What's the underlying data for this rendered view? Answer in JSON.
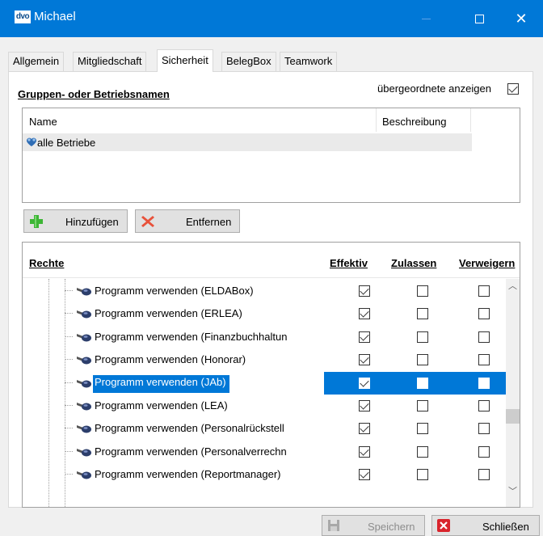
{
  "window": {
    "logo_text": "dvo",
    "title": "Michael",
    "close_symbol": "✕"
  },
  "tabs": [
    {
      "label": "Allgemein"
    },
    {
      "label": "Mitgliedschaft"
    },
    {
      "label": "Sicherheit",
      "active": true
    },
    {
      "label": "BelegBox"
    },
    {
      "label": "Teamwork"
    }
  ],
  "groups": {
    "title": "Gruppen- oder Betriebsnamen",
    "show_parent_label": "übergeordnete anzeigen",
    "show_parent_checked": true,
    "columns": {
      "name": "Name",
      "description": "Beschreibung"
    },
    "rows": [
      {
        "name": "alle Betriebe",
        "icon": "group-icon"
      }
    ]
  },
  "buttons": {
    "add": "Hinzufügen",
    "remove": "Entfernen"
  },
  "rights": {
    "columns": {
      "rights": "Rechte",
      "effective": "Effektiv",
      "allow": "Zulassen",
      "deny": "Verweigern"
    },
    "rows": [
      {
        "label": "Programm verwenden (ELDABox)",
        "effective": true,
        "allow": false,
        "deny": false
      },
      {
        "label": "Programm verwenden (ERLEA)",
        "effective": true,
        "allow": false,
        "deny": false
      },
      {
        "label": "Programm verwenden (Finanzbuchhaltun",
        "effective": true,
        "allow": false,
        "deny": false
      },
      {
        "label": "Programm verwenden (Honorar)",
        "effective": true,
        "allow": false,
        "deny": false
      },
      {
        "label": "Programm verwenden (JAb)",
        "effective": true,
        "allow": false,
        "deny": false,
        "selected": true
      },
      {
        "label": "Programm verwenden (LEA)",
        "effective": true,
        "allow": false,
        "deny": false
      },
      {
        "label": "Programm verwenden (Personalrückstell",
        "effective": true,
        "allow": false,
        "deny": false
      },
      {
        "label": "Programm verwenden (Personalverrechn",
        "effective": true,
        "allow": false,
        "deny": false
      },
      {
        "label": "Programm verwenden (Reportmanager)",
        "effective": true,
        "allow": false,
        "deny": false
      }
    ]
  },
  "footer": {
    "save": "Speichern",
    "save_enabled": false,
    "close": "Schließen"
  },
  "colors": {
    "accent": "#0078d7",
    "remove_icon": "#e8513a",
    "add_icon": "#3db535",
    "close_icon": "#d9242c"
  }
}
